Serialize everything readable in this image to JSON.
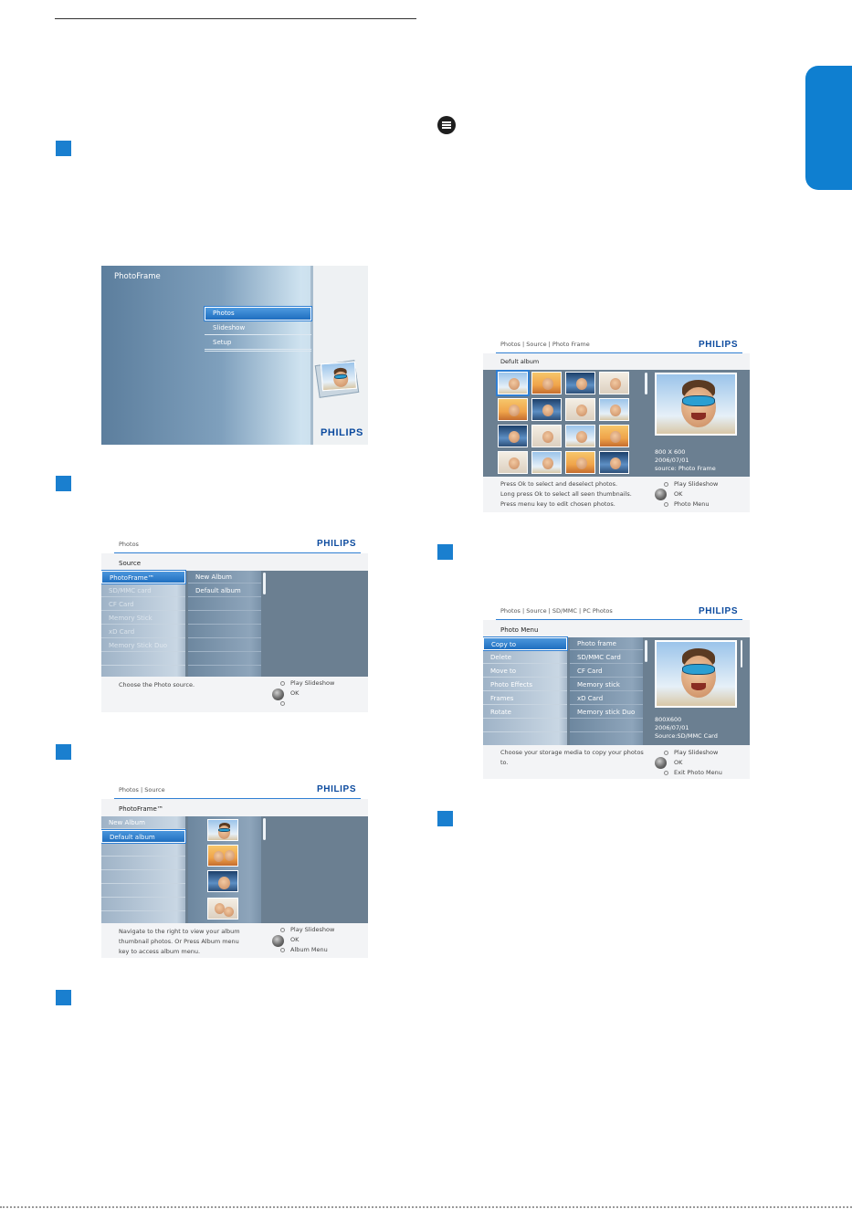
{
  "screens": {
    "main_menu": {
      "title": "PhotoFrame",
      "items": [
        "Photos",
        "Slideshow",
        "Setup"
      ],
      "brand": "PHILIPS"
    },
    "source": {
      "breadcrumb": "Photos",
      "subtitle": "Source",
      "brand": "PHILIPS",
      "sources": [
        "PhotoFrame™",
        "SD/MMC card",
        "CF Card",
        "Memory Stick",
        "xD Card",
        "Memory Stick Duo"
      ],
      "albums": [
        "New Album",
        "Default album"
      ],
      "hint": "Choose the Photo source.",
      "legend": [
        "Play Slideshow",
        "OK",
        ""
      ]
    },
    "album": {
      "breadcrumb": "Photos | Source",
      "subtitle": "PhotoFrame™",
      "brand": "PHILIPS",
      "albums": [
        "New Album",
        "Default album"
      ],
      "hint_lines": [
        "Navigate to the right to view your album",
        "thumbnail photos. Or Press Album menu",
        "key to access album menu."
      ],
      "legend": [
        "Play Slideshow",
        "OK",
        "Album Menu"
      ]
    },
    "thumbs": {
      "breadcrumb": "Photos | Source | Photo Frame",
      "subtitle": "Defult album",
      "brand": "PHILIPS",
      "info_lines": [
        "800 X 600",
        "2006/07/01",
        "source: Photo Frame"
      ],
      "hint_lines": [
        "Press Ok to select and deselect photos.",
        "Long press Ok to select all seen thumbnails.",
        "Press menu key to edit chosen photos."
      ],
      "legend": [
        "Play Slideshow",
        "OK",
        "Photo Menu"
      ]
    },
    "photo_menu": {
      "breadcrumb": "Photos | Source | SD/MMC | PC Photos",
      "subtitle": "Photo Menu",
      "brand": "PHILIPS",
      "actions": [
        "Copy to",
        "Delete",
        "Move to",
        "Photo Effects",
        "Frames",
        "Rotate"
      ],
      "targets": [
        "Photo frame",
        "SD/MMC Card",
        "CF Card",
        "Memory stick",
        "xD Card",
        "Memory stick Duo"
      ],
      "info_lines": [
        "800X600",
        "2006/07/01",
        "Source:SD/MMC Card"
      ],
      "hint_lines": [
        "Choose your storage media to copy your photos",
        "to."
      ],
      "legend": [
        "Play Slideshow",
        "OK",
        "Exit Photo Menu"
      ]
    }
  },
  "colors": {
    "accent": "#1a7fcf",
    "tab": "#0f7fd0",
    "panel": "#6b7f91",
    "brand": "#0b4a9e"
  }
}
